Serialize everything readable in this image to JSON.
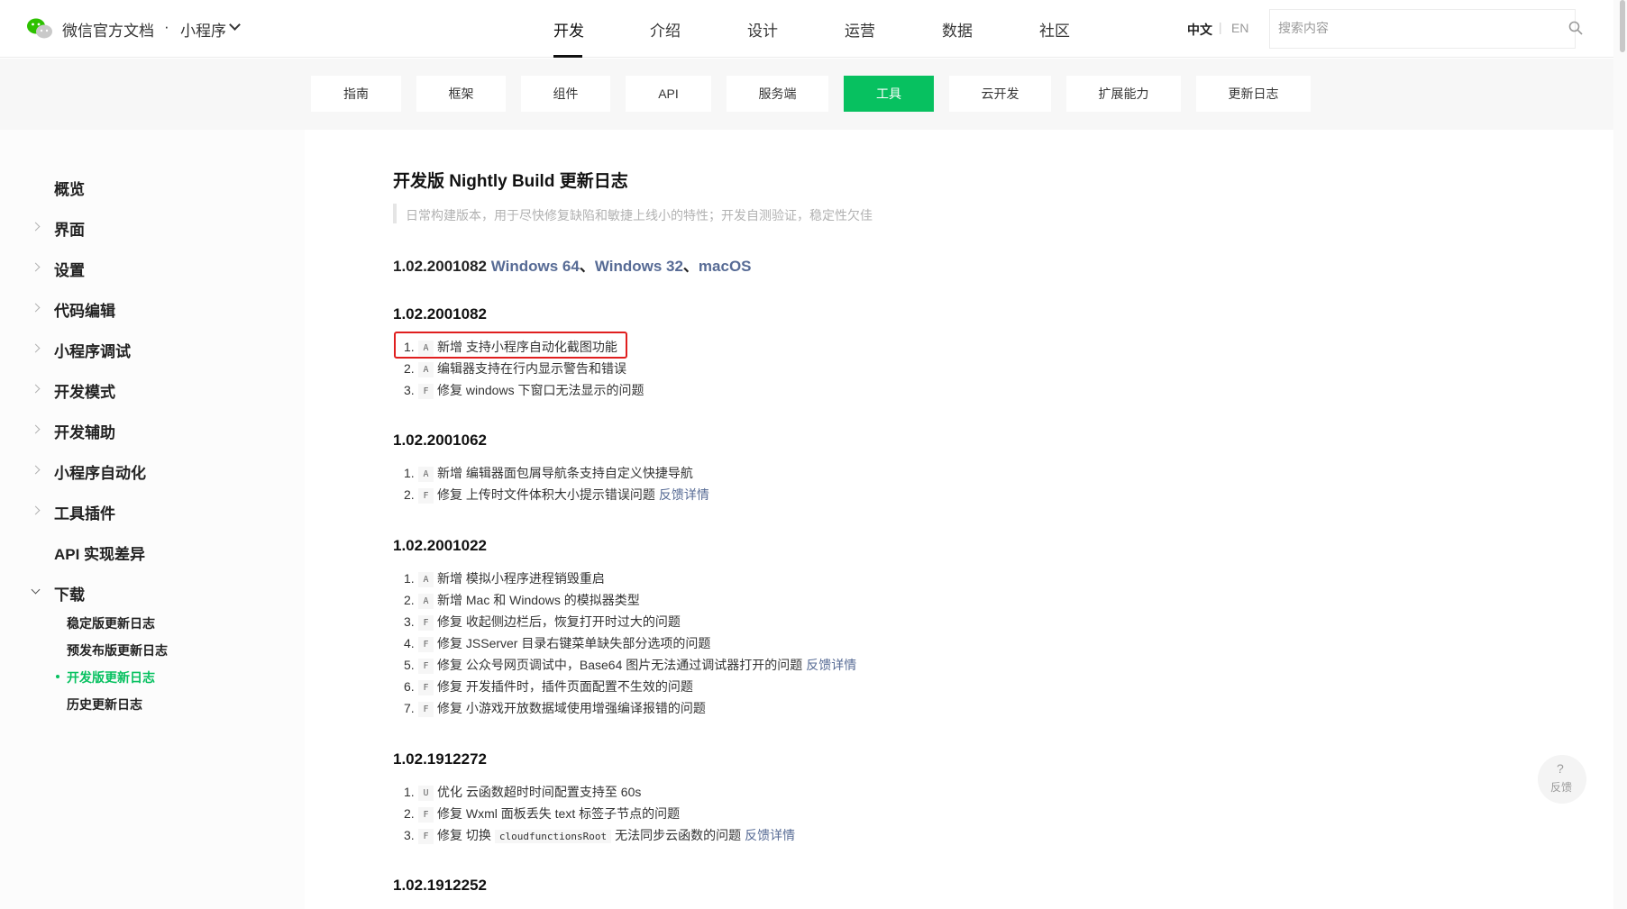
{
  "header": {
    "brand": "微信官方文档",
    "brand_dot": "·",
    "product": "小程序",
    "nav": [
      "开发",
      "介绍",
      "设计",
      "运营",
      "数据",
      "社区"
    ],
    "active_nav": "开发",
    "lang_zh": "中文",
    "lang_sep": "|",
    "lang_en": "EN",
    "search_placeholder": "搜索内容"
  },
  "subnav": {
    "items": [
      "指南",
      "框架",
      "组件",
      "API",
      "服务端",
      "工具",
      "云开发",
      "扩展能力",
      "更新日志"
    ],
    "active": "工具"
  },
  "sidebar": {
    "items": [
      "概览",
      "界面",
      "设置",
      "代码编辑",
      "小程序调试",
      "开发模式",
      "开发辅助",
      "小程序自动化",
      "工具插件",
      "API 实现差异",
      "下载"
    ],
    "sub_items": [
      "稳定版更新日志",
      "预发布版更新日志",
      "开发版更新日志",
      "历史更新日志"
    ],
    "active_sub": "开发版更新日志"
  },
  "content": {
    "title": "开发版 Nightly Build 更新日志",
    "quote": "日常构建版本，用于尽快修复缺陷和敏捷上线小的特性；开发自测验证，稳定性欠佳",
    "download": {
      "version": "1.02.2001082",
      "links": [
        "Windows 64",
        "Windows 32",
        "macOS"
      ],
      "sep": "、"
    },
    "releases": [
      {
        "version": "1.02.2001082",
        "items": [
          {
            "num": "1.",
            "tag": "A",
            "text": "新增 支持小程序自动化截图功能",
            "link": ""
          },
          {
            "num": "2.",
            "tag": "A",
            "text": "编辑器支持在行内显示警告和错误",
            "link": ""
          },
          {
            "num": "3.",
            "tag": "F",
            "text": "修复 windows 下窗口无法显示的问题",
            "link": ""
          }
        ]
      },
      {
        "version": "1.02.2001062",
        "items": [
          {
            "num": "1.",
            "tag": "A",
            "text": "新增 编辑器面包屑导航条支持自定义快捷导航",
            "link": ""
          },
          {
            "num": "2.",
            "tag": "F",
            "text": "修复 上传时文件体积大小提示错误问题",
            "link": "反馈详情"
          }
        ]
      },
      {
        "version": "1.02.2001022",
        "items": [
          {
            "num": "1.",
            "tag": "A",
            "text": "新增 模拟小程序进程销毁重启",
            "link": ""
          },
          {
            "num": "2.",
            "tag": "A",
            "text": "新增 Mac 和 Windows 的模拟器类型",
            "link": ""
          },
          {
            "num": "3.",
            "tag": "F",
            "text": "修复 收起侧边栏后，恢复打开时过大的问题",
            "link": ""
          },
          {
            "num": "4.",
            "tag": "F",
            "text": "修复 JSServer 目录右键菜单缺失部分选项的问题",
            "link": ""
          },
          {
            "num": "5.",
            "tag": "F",
            "text": "修复 公众号网页调试中，Base64 图片无法通过调试器打开的问题",
            "link": "反馈详情"
          },
          {
            "num": "6.",
            "tag": "F",
            "text": "修复 开发插件时，插件页面配置不生效的问题",
            "link": ""
          },
          {
            "num": "7.",
            "tag": "F",
            "text": "修复 小游戏开放数据域使用增强编译报错的问题",
            "link": ""
          }
        ]
      },
      {
        "version": "1.02.1912272",
        "items": [
          {
            "num": "1.",
            "tag": "U",
            "text": "优化 云函数超时时间配置支持至 60s",
            "link": ""
          },
          {
            "num": "2.",
            "tag": "F",
            "text": "修复 Wxml 面板丢失 text 标签子节点的问题",
            "link": ""
          },
          {
            "num": "3.",
            "tag": "F",
            "text_before": "修复 切换",
            "code": "cloudfunctionsRoot",
            "text_after": "无法同步云函数的问题",
            "link": "反馈详情"
          }
        ]
      },
      {
        "version": "1.02.1912252",
        "items": []
      }
    ]
  },
  "feedback": {
    "icon": "?",
    "label": "反馈"
  },
  "colors": {
    "accent": "#07c160",
    "link": "#576b95",
    "highlight": "#e01f1f"
  }
}
